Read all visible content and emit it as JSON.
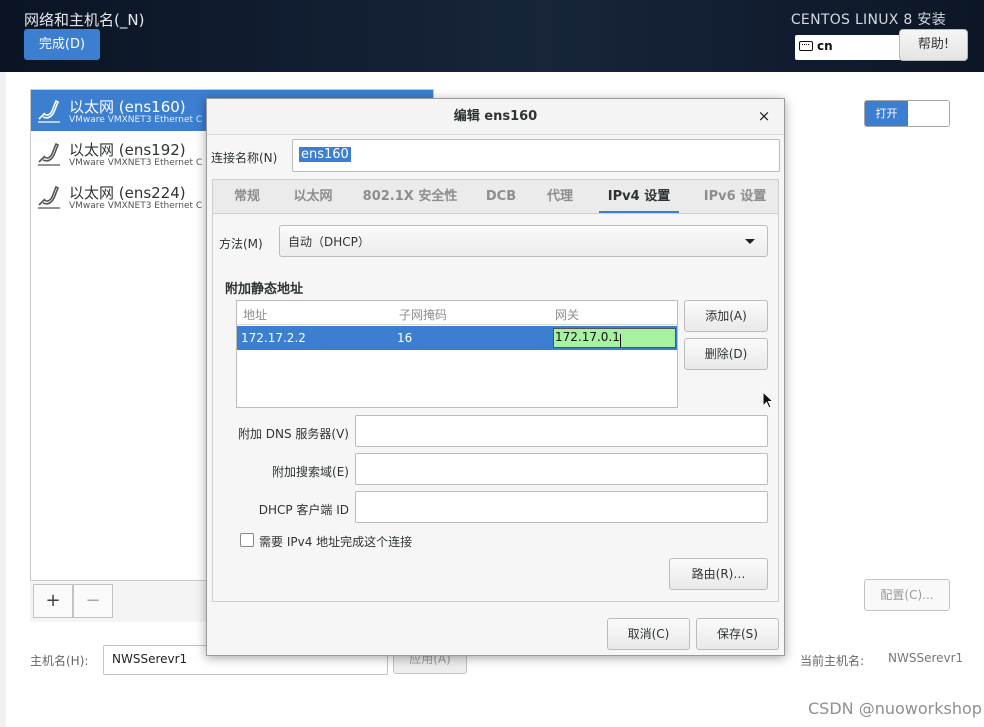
{
  "header": {
    "title": "网络和主机名(_N)",
    "done_label": "完成(D)",
    "product": "CENTOS LINUX 8 安装",
    "keyboard_layout": "cn",
    "help_label": "帮助!"
  },
  "devices": [
    {
      "name": "以太网 (ens160)",
      "desc": "VMware VMXNET3 Ethernet C",
      "selected": true
    },
    {
      "name": "以太网 (ens192)",
      "desc": "VMware VMXNET3 Ethernet C",
      "selected": false
    },
    {
      "name": "以太网 (ens224)",
      "desc": "VMware VMXNET3 Ethernet C",
      "selected": false
    }
  ],
  "device_toolbar": {
    "add": "+",
    "remove": "−"
  },
  "toggle_label": "打开",
  "configure_label": "配置(C)...",
  "hostname": {
    "label": "主机名(H):",
    "value": "NWSSerevr1",
    "apply_label": "应用(A)",
    "current_label": "当前主机名:",
    "current_value": "NWSSerevr1"
  },
  "watermark": "CSDN @nuoworkshop",
  "dialog": {
    "title": "编辑 ens160",
    "close": "×",
    "connection_name_label": "连接名称(N)",
    "connection_name_value": "ens160",
    "tabs": [
      "常规",
      "以太网",
      "802.1X 安全性",
      "DCB",
      "代理",
      "IPv4 设置",
      "IPv6 设置"
    ],
    "active_tab": "IPv4 设置",
    "method_label": "方法(M)",
    "method_value": "自动（DHCP）",
    "static_title": "附加静态地址",
    "columns": [
      "地址",
      "子网掩码",
      "网关"
    ],
    "rows": [
      {
        "address": "172.17.2.2",
        "netmask": "16",
        "gateway": "172.17.0.1"
      }
    ],
    "add_label": "添加(A)",
    "delete_label": "删除(D)",
    "dns_label": "附加 DNS 服务器(V)",
    "search_label": "附加搜索域(E)",
    "dhcp_label": "DHCP 客户端 ID",
    "require_label": "需要 IPv4 地址完成这个连接",
    "routes_label": "路由(R)…",
    "cancel_label": "取消(C)",
    "save_label": "保存(S)"
  },
  "colors": {
    "accent": "#3c7ed0",
    "gateway_edit": "#a6f2a0",
    "header_bg": "#0f1b2d"
  }
}
